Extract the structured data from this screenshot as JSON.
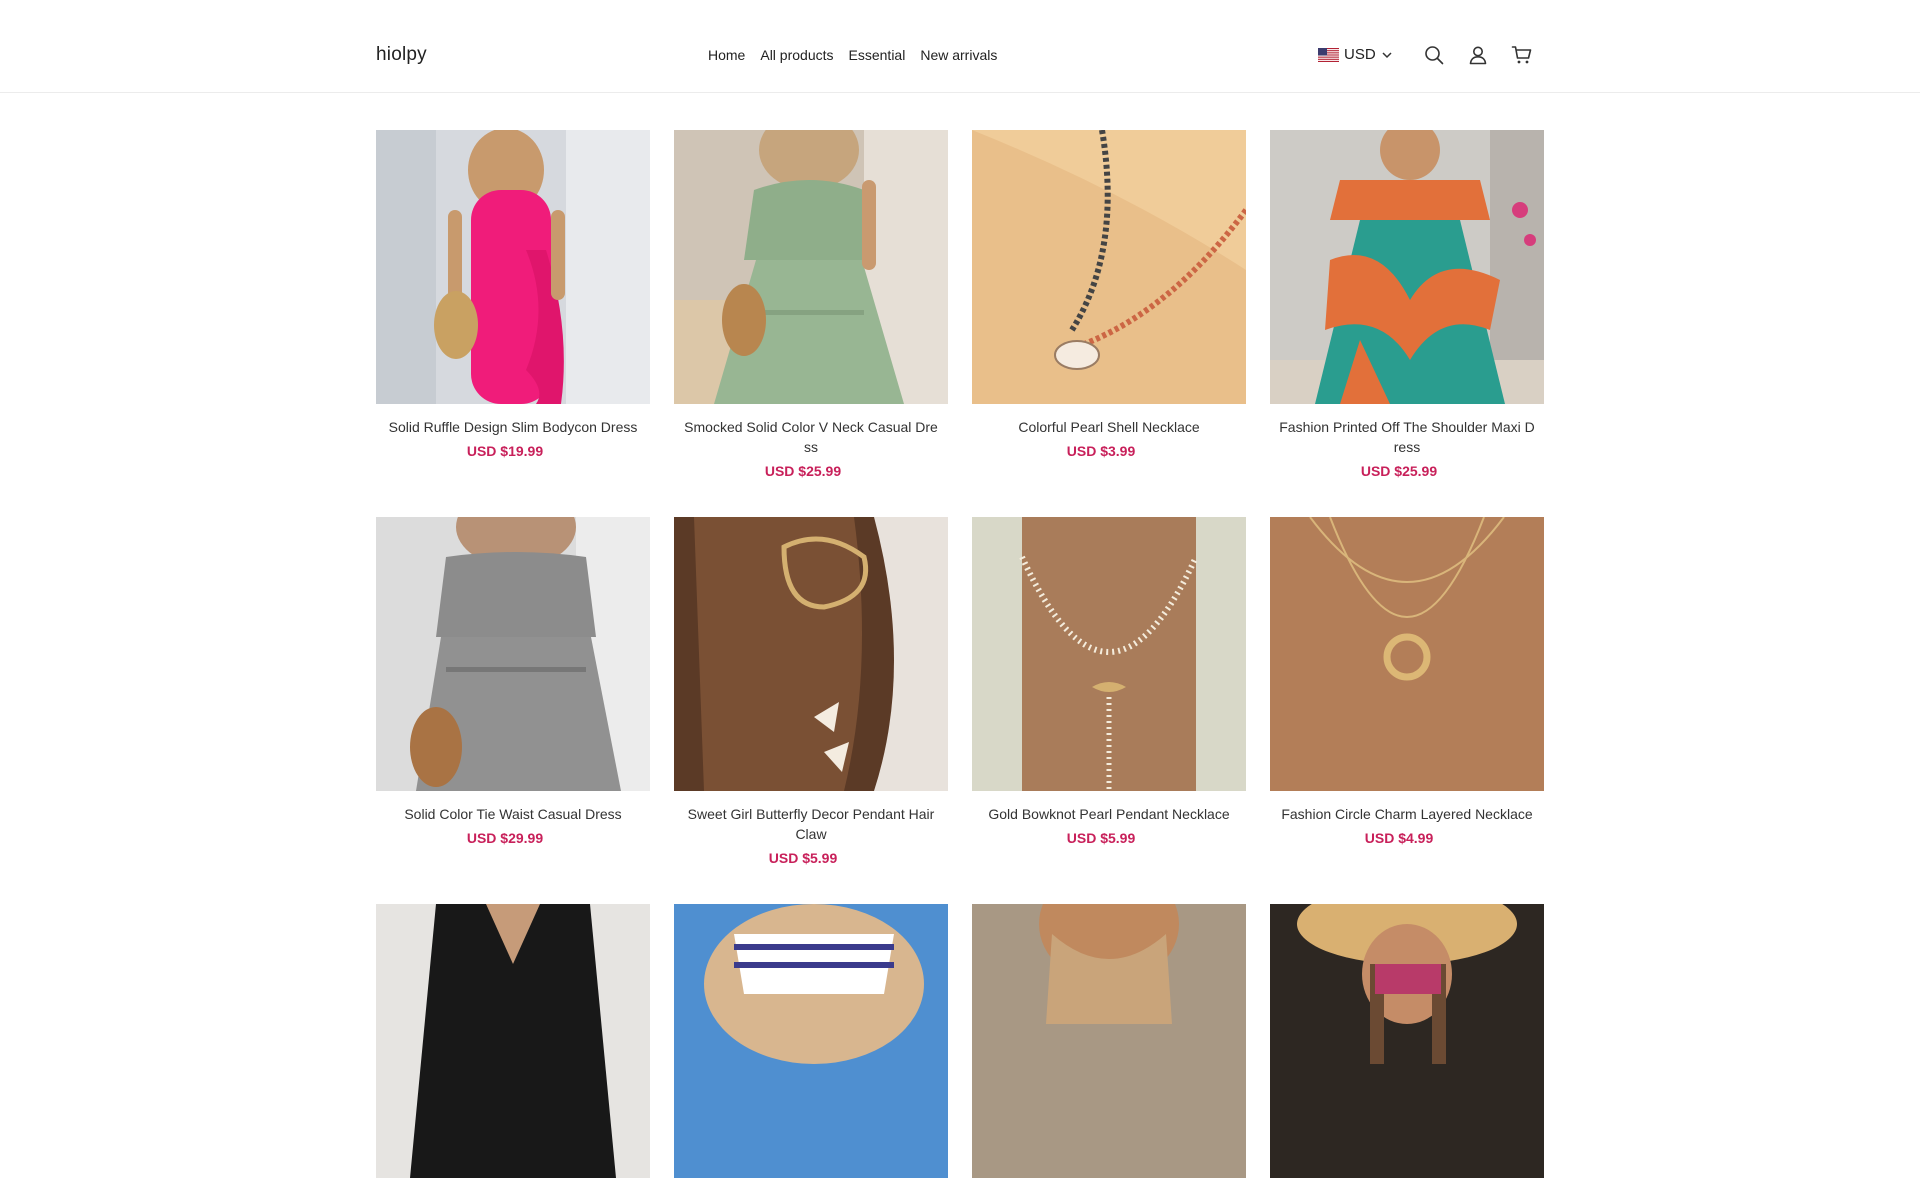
{
  "header": {
    "logo": "hiolpy",
    "nav": [
      "Home",
      "All products",
      "Essential",
      "New arrivals"
    ],
    "currency": "USD",
    "icons": [
      "search-icon",
      "account-icon",
      "cart-icon"
    ]
  },
  "colors": {
    "price": "#c8205a",
    "text": "#222222",
    "border": "#ececec"
  },
  "products": [
    {
      "title": "Solid Ruffle Design Slim Bodycon Dress",
      "price": "USD $19.99"
    },
    {
      "title": "Smocked Solid Color V Neck Casual Dress",
      "price": "USD $25.99"
    },
    {
      "title": "Colorful Pearl Shell Necklace",
      "price": "USD $3.99"
    },
    {
      "title": "Fashion Printed Off The Shoulder Maxi Dress",
      "price": "USD $25.99"
    },
    {
      "title": "Solid Color Tie Waist Casual Dress",
      "price": "USD $29.99"
    },
    {
      "title": "Sweet Girl Butterfly Decor Pendant Hair Claw",
      "price": "USD $5.99"
    },
    {
      "title": "Gold Bowknot Pearl Pendant Necklace",
      "price": "USD $5.99"
    },
    {
      "title": "Fashion Circle Charm Layered Necklace",
      "price": "USD $4.99"
    },
    {
      "title": "",
      "price": ""
    },
    {
      "title": "",
      "price": ""
    },
    {
      "title": "",
      "price": ""
    },
    {
      "title": "",
      "price": ""
    }
  ]
}
